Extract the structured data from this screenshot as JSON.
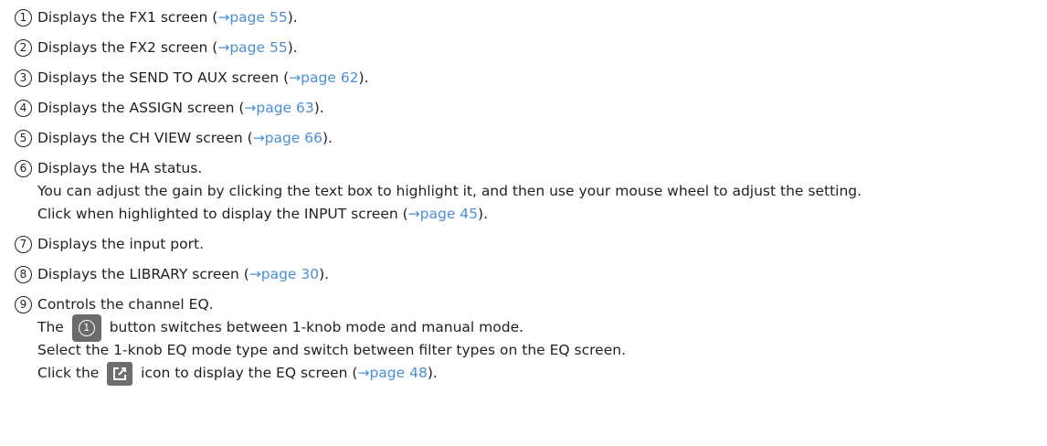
{
  "items": [
    {
      "num": "1",
      "lines": [
        {
          "pre": "Displays the FX1 screen (",
          "link": "→page 55",
          "post": ")."
        }
      ]
    },
    {
      "num": "2",
      "lines": [
        {
          "pre": "Displays the FX2 screen (",
          "link": "→page 55",
          "post": ")."
        }
      ]
    },
    {
      "num": "3",
      "lines": [
        {
          "pre": "Displays the SEND TO AUX screen (",
          "link": "→page 62",
          "post": ")."
        }
      ]
    },
    {
      "num": "4",
      "lines": [
        {
          "pre": "Displays the ASSIGN screen (",
          "link": "→page 63",
          "post": ")."
        }
      ]
    },
    {
      "num": "5",
      "lines": [
        {
          "pre": "Displays the CH VIEW screen (",
          "link": "→page 66",
          "post": ")."
        }
      ]
    },
    {
      "num": "6",
      "lines": [
        {
          "text": "Displays the HA status."
        },
        {
          "text": "You can adjust the gain by clicking the text box to highlight it, and then use your mouse wheel to adjust the setting."
        },
        {
          "pre": "Click when highlighted to display the INPUT screen (",
          "link": "→page 45",
          "post": ")."
        }
      ]
    },
    {
      "num": "7",
      "lines": [
        {
          "text": "Displays the input port."
        }
      ]
    },
    {
      "num": "8",
      "lines": [
        {
          "pre": "Displays the LIBRARY screen (",
          "link": "→page 30",
          "post": ")."
        }
      ]
    },
    {
      "num": "9",
      "lines": [
        {
          "text": "Controls the channel EQ."
        },
        {
          "pre": "The",
          "icon": "one-knob-button-icon",
          "icon_label": "1",
          "post": "button switches between 1-knob mode and manual mode."
        },
        {
          "text": "Select the 1-knob EQ mode type and switch between filter types on the EQ screen."
        },
        {
          "pre": "Click the",
          "icon": "edit-icon",
          "post2": "icon to display the EQ screen (",
          "link": "→page 48",
          "post": ")."
        }
      ]
    }
  ],
  "colors": {
    "text": "#231f20",
    "link": "#4a8fd6",
    "icon_bg": "#6b6b6b"
  }
}
